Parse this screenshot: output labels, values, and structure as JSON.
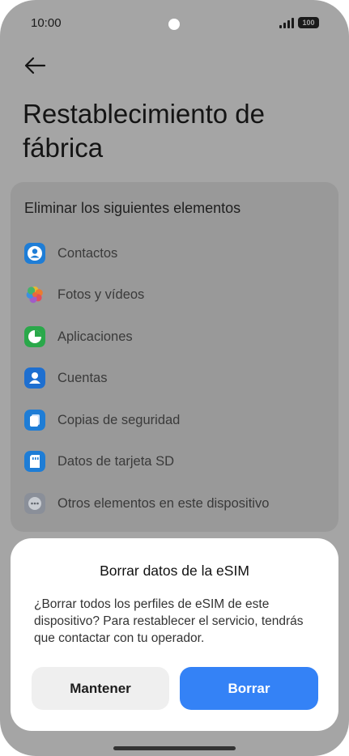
{
  "status_bar": {
    "time": "10:00",
    "battery": "100"
  },
  "page": {
    "title": "Restablecimiento de fábrica"
  },
  "card": {
    "heading": "Eliminar los siguientes elementos",
    "items": [
      {
        "label": "Contactos",
        "icon": "contacts-icon",
        "color": "#1e7dd6"
      },
      {
        "label": "Fotos y vídeos",
        "icon": "gallery-icon",
        "color": "#e86a3a"
      },
      {
        "label": "Aplicaciones",
        "icon": "apps-icon",
        "color": "#2aa84a"
      },
      {
        "label": "Cuentas",
        "icon": "accounts-icon",
        "color": "#1e6fd0"
      },
      {
        "label": "Copias de seguridad",
        "icon": "backup-icon",
        "color": "#1e7dd6"
      },
      {
        "label": "Datos de tarjeta SD",
        "icon": "sd-card-icon",
        "color": "#1e7dd6"
      },
      {
        "label": "Otros elementos en este dispositivo",
        "icon": "more-icon",
        "color": "#8a8f99"
      }
    ]
  },
  "dialog": {
    "title": "Borrar datos de la eSIM",
    "message": "¿Borrar todos los perfiles de eSIM de este dispositivo? Para restablecer el servicio, tendrás que contactar con tu operador.",
    "keep_label": "Mantener",
    "erase_label": "Borrar"
  },
  "colors": {
    "accent": "#3482f6",
    "scrim": "#a5a5a5"
  }
}
